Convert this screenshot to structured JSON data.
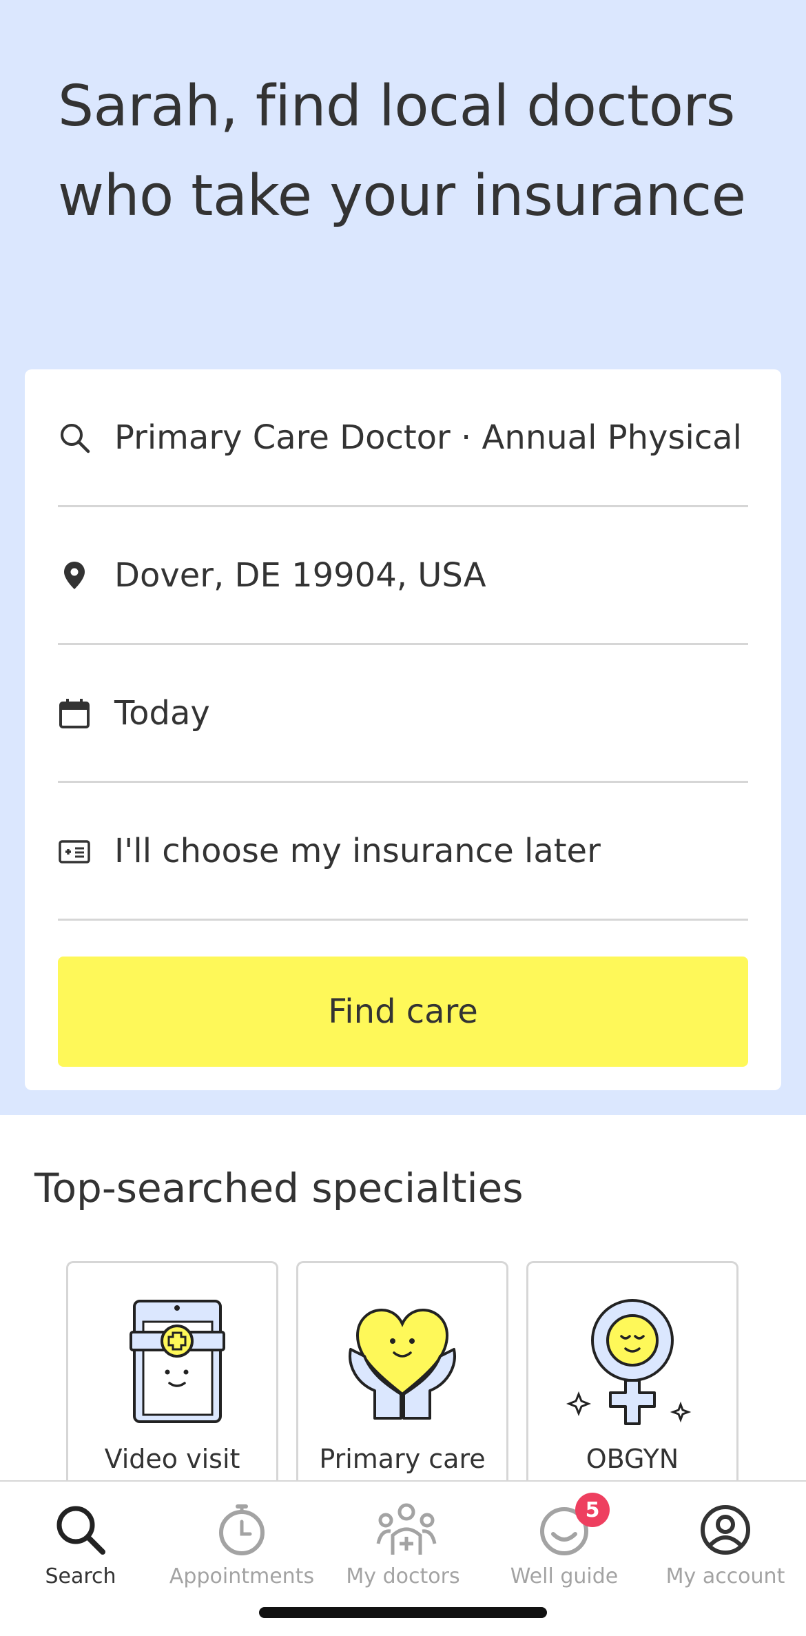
{
  "hero": {
    "headline": "Sarah, find local doctors who take your insurance"
  },
  "search": {
    "specialty": "Primary Care Doctor · Annual Physical",
    "location": "Dover, DE 19904, USA",
    "date": "Today",
    "insurance": "I'll choose my insurance later",
    "button_label": "Find care"
  },
  "specialties": {
    "title": "Top-searched specialties",
    "items": [
      {
        "label": "Video visit",
        "icon": "video-visit-icon"
      },
      {
        "label": "Primary care",
        "icon": "heart-hands-icon"
      },
      {
        "label": "OBGYN",
        "icon": "female-symbol-icon"
      }
    ]
  },
  "tabbar": {
    "tabs": [
      {
        "label": "Search",
        "icon": "search-icon",
        "active": true
      },
      {
        "label": "Appointments",
        "icon": "stopwatch-icon"
      },
      {
        "label": "My doctors",
        "icon": "people-icon"
      },
      {
        "label": "Well guide",
        "icon": "smile-icon",
        "badge": "5"
      },
      {
        "label": "My account",
        "icon": "account-icon"
      }
    ]
  },
  "colors": {
    "hero_bg": "#dbe7fe",
    "button_bg": "#fef859",
    "badge_bg": "#ee3f5f",
    "text": "#333333",
    "inactive_tab": "#a3a3a3"
  }
}
